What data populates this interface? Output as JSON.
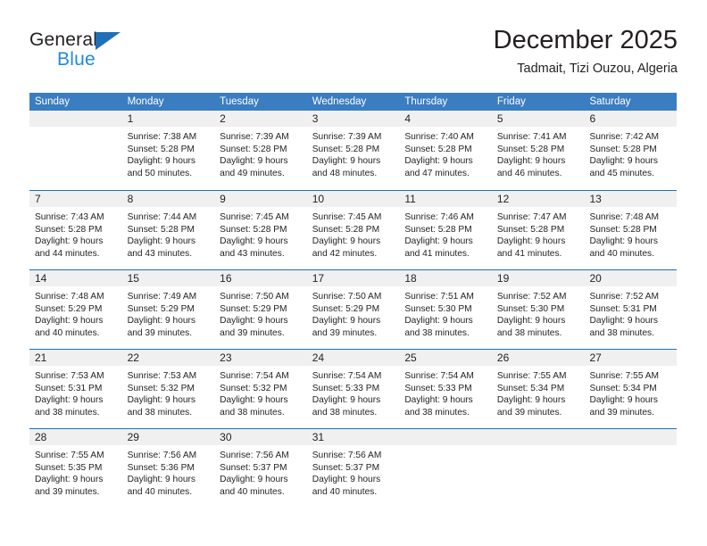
{
  "logo": {
    "general_text": "General",
    "blue_text": "Blue",
    "triangle_color": "#1f70b8"
  },
  "header": {
    "title": "December 2025",
    "subtitle": "Tadmait, Tizi Ouzou, Algeria"
  },
  "theme": {
    "header_blue": "#3a7dc0",
    "rule_blue": "#1f70b8",
    "day_band_gray": "#f0f0f0",
    "text": "#231f20"
  },
  "weekdays": [
    "Sunday",
    "Monday",
    "Tuesday",
    "Wednesday",
    "Thursday",
    "Friday",
    "Saturday"
  ],
  "weeks": [
    [
      {
        "day": "",
        "lines": []
      },
      {
        "day": "1",
        "lines": [
          "Sunrise: 7:38 AM",
          "Sunset: 5:28 PM",
          "Daylight: 9 hours",
          "and 50 minutes."
        ]
      },
      {
        "day": "2",
        "lines": [
          "Sunrise: 7:39 AM",
          "Sunset: 5:28 PM",
          "Daylight: 9 hours",
          "and 49 minutes."
        ]
      },
      {
        "day": "3",
        "lines": [
          "Sunrise: 7:39 AM",
          "Sunset: 5:28 PM",
          "Daylight: 9 hours",
          "and 48 minutes."
        ]
      },
      {
        "day": "4",
        "lines": [
          "Sunrise: 7:40 AM",
          "Sunset: 5:28 PM",
          "Daylight: 9 hours",
          "and 47 minutes."
        ]
      },
      {
        "day": "5",
        "lines": [
          "Sunrise: 7:41 AM",
          "Sunset: 5:28 PM",
          "Daylight: 9 hours",
          "and 46 minutes."
        ]
      },
      {
        "day": "6",
        "lines": [
          "Sunrise: 7:42 AM",
          "Sunset: 5:28 PM",
          "Daylight: 9 hours",
          "and 45 minutes."
        ]
      }
    ],
    [
      {
        "day": "7",
        "lines": [
          "Sunrise: 7:43 AM",
          "Sunset: 5:28 PM",
          "Daylight: 9 hours",
          "and 44 minutes."
        ]
      },
      {
        "day": "8",
        "lines": [
          "Sunrise: 7:44 AM",
          "Sunset: 5:28 PM",
          "Daylight: 9 hours",
          "and 43 minutes."
        ]
      },
      {
        "day": "9",
        "lines": [
          "Sunrise: 7:45 AM",
          "Sunset: 5:28 PM",
          "Daylight: 9 hours",
          "and 43 minutes."
        ]
      },
      {
        "day": "10",
        "lines": [
          "Sunrise: 7:45 AM",
          "Sunset: 5:28 PM",
          "Daylight: 9 hours",
          "and 42 minutes."
        ]
      },
      {
        "day": "11",
        "lines": [
          "Sunrise: 7:46 AM",
          "Sunset: 5:28 PM",
          "Daylight: 9 hours",
          "and 41 minutes."
        ]
      },
      {
        "day": "12",
        "lines": [
          "Sunrise: 7:47 AM",
          "Sunset: 5:28 PM",
          "Daylight: 9 hours",
          "and 41 minutes."
        ]
      },
      {
        "day": "13",
        "lines": [
          "Sunrise: 7:48 AM",
          "Sunset: 5:28 PM",
          "Daylight: 9 hours",
          "and 40 minutes."
        ]
      }
    ],
    [
      {
        "day": "14",
        "lines": [
          "Sunrise: 7:48 AM",
          "Sunset: 5:29 PM",
          "Daylight: 9 hours",
          "and 40 minutes."
        ]
      },
      {
        "day": "15",
        "lines": [
          "Sunrise: 7:49 AM",
          "Sunset: 5:29 PM",
          "Daylight: 9 hours",
          "and 39 minutes."
        ]
      },
      {
        "day": "16",
        "lines": [
          "Sunrise: 7:50 AM",
          "Sunset: 5:29 PM",
          "Daylight: 9 hours",
          "and 39 minutes."
        ]
      },
      {
        "day": "17",
        "lines": [
          "Sunrise: 7:50 AM",
          "Sunset: 5:29 PM",
          "Daylight: 9 hours",
          "and 39 minutes."
        ]
      },
      {
        "day": "18",
        "lines": [
          "Sunrise: 7:51 AM",
          "Sunset: 5:30 PM",
          "Daylight: 9 hours",
          "and 38 minutes."
        ]
      },
      {
        "day": "19",
        "lines": [
          "Sunrise: 7:52 AM",
          "Sunset: 5:30 PM",
          "Daylight: 9 hours",
          "and 38 minutes."
        ]
      },
      {
        "day": "20",
        "lines": [
          "Sunrise: 7:52 AM",
          "Sunset: 5:31 PM",
          "Daylight: 9 hours",
          "and 38 minutes."
        ]
      }
    ],
    [
      {
        "day": "21",
        "lines": [
          "Sunrise: 7:53 AM",
          "Sunset: 5:31 PM",
          "Daylight: 9 hours",
          "and 38 minutes."
        ]
      },
      {
        "day": "22",
        "lines": [
          "Sunrise: 7:53 AM",
          "Sunset: 5:32 PM",
          "Daylight: 9 hours",
          "and 38 minutes."
        ]
      },
      {
        "day": "23",
        "lines": [
          "Sunrise: 7:54 AM",
          "Sunset: 5:32 PM",
          "Daylight: 9 hours",
          "and 38 minutes."
        ]
      },
      {
        "day": "24",
        "lines": [
          "Sunrise: 7:54 AM",
          "Sunset: 5:33 PM",
          "Daylight: 9 hours",
          "and 38 minutes."
        ]
      },
      {
        "day": "25",
        "lines": [
          "Sunrise: 7:54 AM",
          "Sunset: 5:33 PM",
          "Daylight: 9 hours",
          "and 38 minutes."
        ]
      },
      {
        "day": "26",
        "lines": [
          "Sunrise: 7:55 AM",
          "Sunset: 5:34 PM",
          "Daylight: 9 hours",
          "and 39 minutes."
        ]
      },
      {
        "day": "27",
        "lines": [
          "Sunrise: 7:55 AM",
          "Sunset: 5:34 PM",
          "Daylight: 9 hours",
          "and 39 minutes."
        ]
      }
    ],
    [
      {
        "day": "28",
        "lines": [
          "Sunrise: 7:55 AM",
          "Sunset: 5:35 PM",
          "Daylight: 9 hours",
          "and 39 minutes."
        ]
      },
      {
        "day": "29",
        "lines": [
          "Sunrise: 7:56 AM",
          "Sunset: 5:36 PM",
          "Daylight: 9 hours",
          "and 40 minutes."
        ]
      },
      {
        "day": "30",
        "lines": [
          "Sunrise: 7:56 AM",
          "Sunset: 5:37 PM",
          "Daylight: 9 hours",
          "and 40 minutes."
        ]
      },
      {
        "day": "31",
        "lines": [
          "Sunrise: 7:56 AM",
          "Sunset: 5:37 PM",
          "Daylight: 9 hours",
          "and 40 minutes."
        ]
      },
      {
        "day": "",
        "lines": []
      },
      {
        "day": "",
        "lines": []
      },
      {
        "day": "",
        "lines": []
      }
    ]
  ]
}
